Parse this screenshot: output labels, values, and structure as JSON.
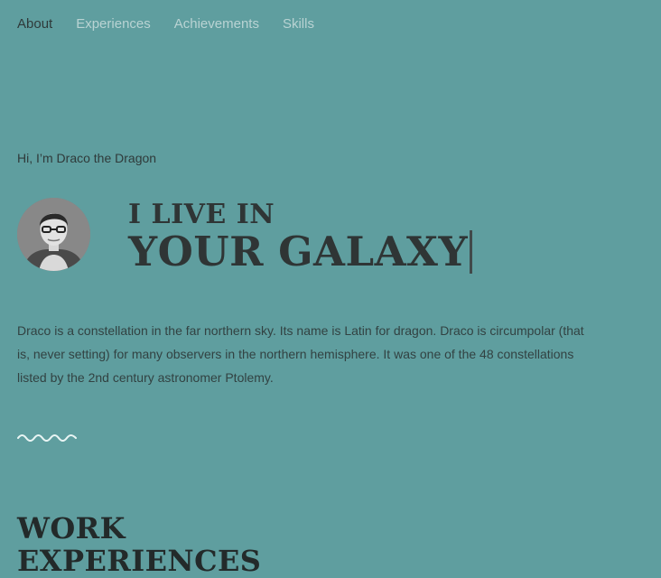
{
  "nav": {
    "items": [
      {
        "label": "About",
        "active": true
      },
      {
        "label": "Experiences",
        "active": false
      },
      {
        "label": "Achievements",
        "active": false
      },
      {
        "label": "Skills",
        "active": false
      }
    ]
  },
  "hero": {
    "greeting": "Hi, I’m Draco the Dragon",
    "headline_line1": "I LIVE IN",
    "headline_line2": "YOUR GALAXY"
  },
  "bio": {
    "text": "Draco is a constellation in the far northern sky. Its name is Latin for dragon. Draco is circumpolar (that is, never setting) for many observers in the northern hemisphere. It was one of the 48 constellations listed by the 2nd century astronomer Ptolemy."
  },
  "section": {
    "title_line1": "WORK",
    "title_line2": "EXPERIENCES"
  },
  "colors": {
    "background": "#5f9e9f",
    "nav_inactive": "#b9d3d3",
    "text_dark": "#2f3a3a"
  }
}
